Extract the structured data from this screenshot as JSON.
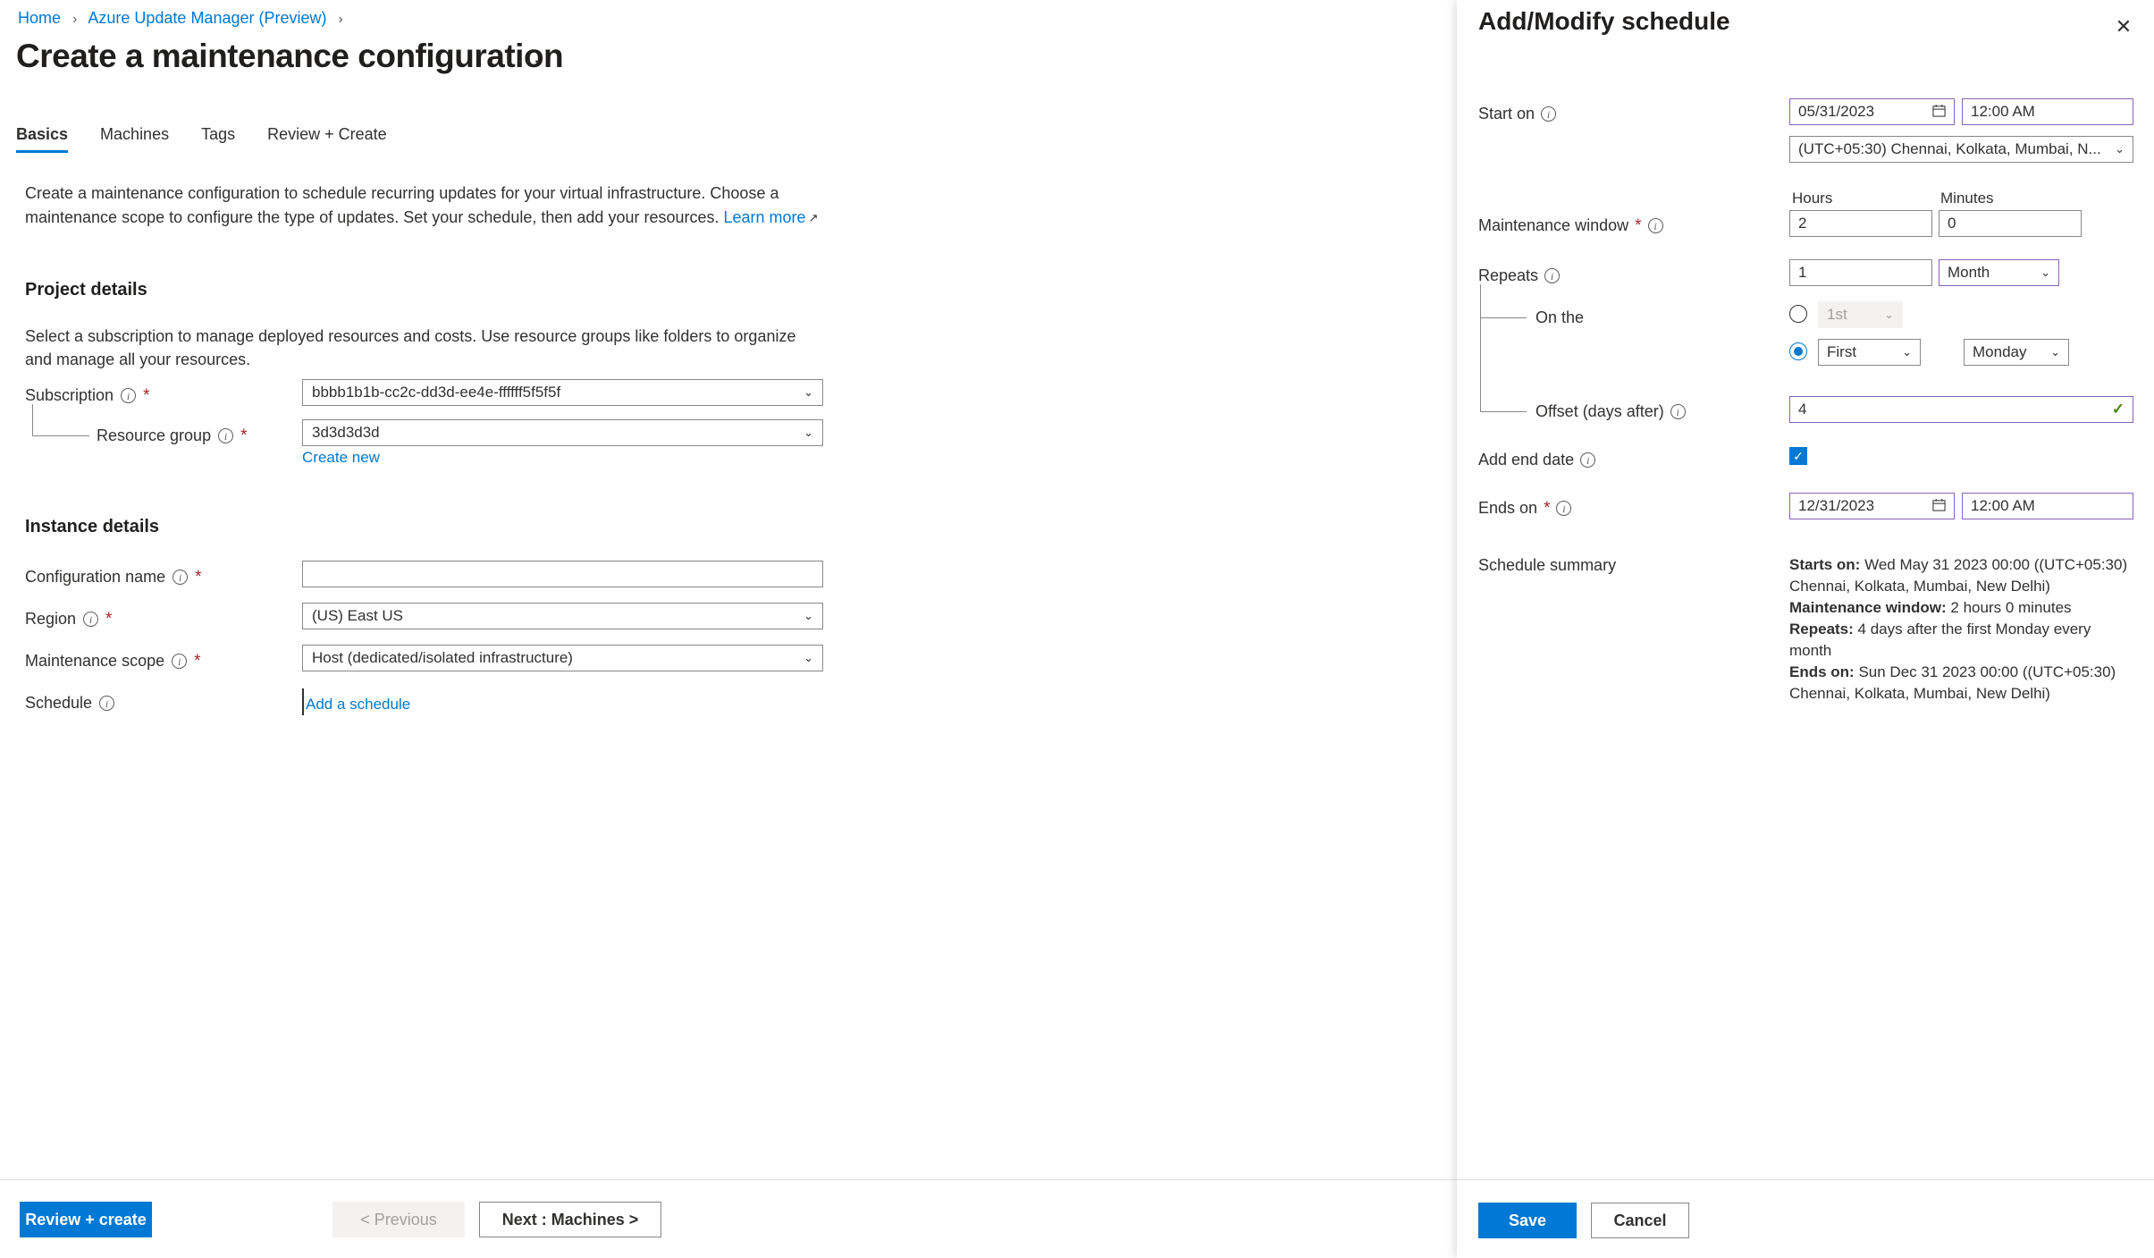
{
  "breadcrumb": {
    "home": "Home",
    "section": "Azure Update Manager (Preview)",
    "separator": "›"
  },
  "page": {
    "title": "Create a maintenance configuration",
    "ellipsis": "···",
    "intro": "Create a maintenance configuration to schedule recurring updates for your virtual infrastructure. Choose a maintenance scope to configure the type of updates. Set your schedule, then add your resources.",
    "learn_more": "Learn more",
    "external_icon": "↗"
  },
  "tabs": [
    {
      "label": "Basics",
      "active": true
    },
    {
      "label": "Machines",
      "active": false
    },
    {
      "label": "Tags",
      "active": false
    },
    {
      "label": "Review + Create",
      "active": false
    }
  ],
  "project_details": {
    "heading": "Project details",
    "description": "Select a subscription to manage deployed resources and costs. Use resource groups like folders to organize and manage all your resources.",
    "subscription": {
      "label": "Subscription",
      "value": "bbbb1b1b-cc2c-dd3d-ee4e-ffffff5f5f5f",
      "required": "*"
    },
    "resource_group": {
      "label": "Resource group",
      "value": "3d3d3d3d",
      "required": "*",
      "create_new": "Create new"
    }
  },
  "instance_details": {
    "heading": "Instance details",
    "configuration_name": {
      "label": "Configuration name",
      "value": "",
      "placeholder": "",
      "required": "*"
    },
    "region": {
      "label": "Region",
      "value": "(US) East US",
      "required": "*"
    },
    "maintenance_scope": {
      "label": "Maintenance scope",
      "value": "Host (dedicated/isolated infrastructure)",
      "required": "*"
    },
    "schedule": {
      "label": "Schedule",
      "link": "Add a schedule"
    }
  },
  "footer": {
    "review_create": "Review + create",
    "previous": "< Previous",
    "next": "Next : Machines >"
  },
  "panel": {
    "title": "Add/Modify schedule",
    "close_icon": "✕",
    "start_on": {
      "label": "Start on",
      "date": "05/31/2023",
      "time": "12:00 AM",
      "timezone": "(UTC+05:30) Chennai, Kolkata, Mumbai, N..."
    },
    "maintenance_window": {
      "label": "Maintenance window",
      "required": "*",
      "hours_header": "Hours",
      "minutes_header": "Minutes",
      "hours": "2",
      "minutes": "0"
    },
    "repeats": {
      "label": "Repeats",
      "count": "1",
      "unit": "Month"
    },
    "on_the": {
      "label": "On the",
      "ordinal_day_value": "1st",
      "ordinal_day_selected": false,
      "week_ordinal": "First",
      "weekday": "Monday",
      "week_selected": true
    },
    "offset": {
      "label": "Offset (days after)",
      "value": "4",
      "valid_icon": "✓"
    },
    "add_end_date": {
      "label": "Add end date",
      "checked": true,
      "check_icon": "✓"
    },
    "ends_on": {
      "label": "Ends on",
      "required": "*",
      "date": "12/31/2023",
      "time": "12:00 AM"
    },
    "schedule_summary": {
      "label": "Schedule summary",
      "starts_on_label": "Starts on:",
      "starts_on_value": "Wed May 31 2023 00:00 ((UTC+05:30) Chennai, Kolkata, Mumbai, New Delhi)",
      "window_label": "Maintenance window:",
      "window_value": "2 hours 0 minutes",
      "repeats_label": "Repeats:",
      "repeats_value": "4 days after the first Monday every month",
      "ends_on_label": "Ends on:",
      "ends_on_value": "Sun Dec 31 2023 00:00 ((UTC+05:30) Chennai, Kolkata, Mumbai, New Delhi)"
    },
    "save": "Save",
    "cancel": "Cancel"
  },
  "icons": {
    "info": "i",
    "chevron_down": "⌄",
    "calendar": "Ὄ5"
  },
  "colors": {
    "accent": "#0078d4",
    "modified_border": "#8764b8",
    "valid_green": "#498205",
    "required_red": "#a4262c"
  }
}
